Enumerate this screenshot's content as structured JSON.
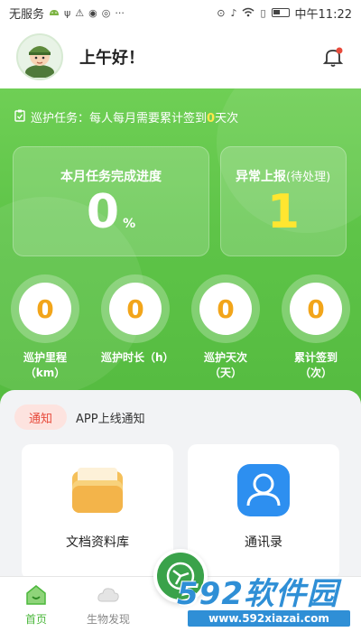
{
  "status_bar": {
    "carrier": "无服务",
    "time": "中午11:22"
  },
  "header": {
    "greeting": "上午好！"
  },
  "patrol_task": {
    "prefix": "巡护任务：每人每月需要累计签到",
    "count": "0",
    "suffix": "天次"
  },
  "progress_card": {
    "title": "本月任务完成进度",
    "value": "0",
    "unit": "%"
  },
  "abnormal_card": {
    "title": "异常上报",
    "subtitle": "(待处理)",
    "value": "1"
  },
  "stats": [
    {
      "value": "0",
      "label": "巡护里程（km）"
    },
    {
      "value": "0",
      "label": "巡护时长（h）"
    },
    {
      "value": "0",
      "label": "巡护天次（天）"
    },
    {
      "value": "0",
      "label": "累计签到（次）"
    }
  ],
  "notice": {
    "tag": "通知",
    "text": "APP上线通知"
  },
  "tiles": {
    "docs": "文档资料库",
    "contacts": "通讯录"
  },
  "tabbar": {
    "home": "首页",
    "bio": "生物发现"
  },
  "watermark": {
    "main": "592软件园",
    "url": "www.592xiazai.com"
  },
  "colors": {
    "primary_green": "#5ec448",
    "highlight_yellow": "#ffe630",
    "stat_orange": "#f2a51a",
    "notice_red": "#e74a3b"
  }
}
